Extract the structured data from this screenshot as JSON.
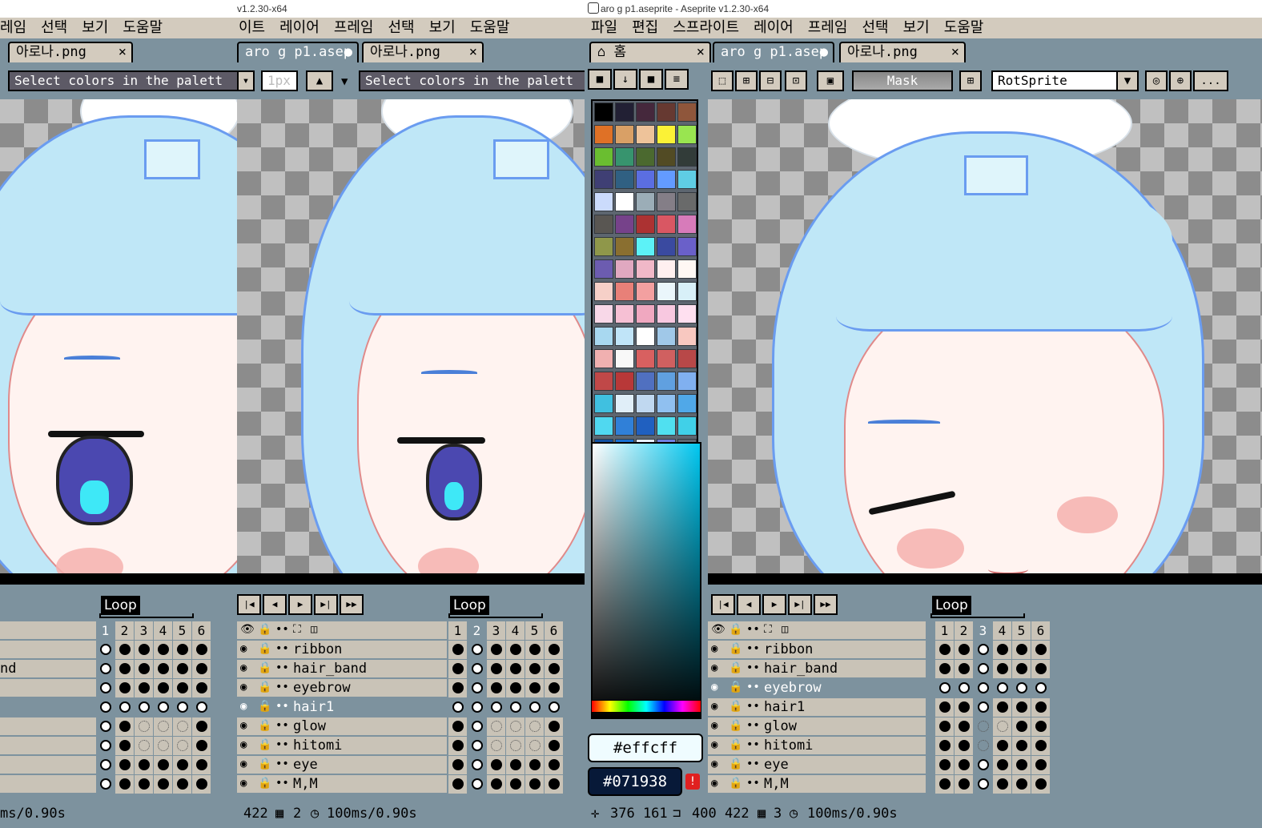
{
  "windows": {
    "left_title": "v1.2.30-x64",
    "right_title": "aro g p1.aseprite - Aseprite v1.2.30-x64"
  },
  "menus": {
    "partial_left": [
      "레임",
      "선택",
      "보기",
      "도움말"
    ],
    "middle": [
      "이트",
      "레이어",
      "프레임",
      "선택",
      "보기",
      "도움말"
    ],
    "right": [
      "파일",
      "편집",
      "스프라이트",
      "레이어",
      "프레임",
      "선택",
      "보기",
      "도움말"
    ]
  },
  "tabs": {
    "left": [
      {
        "label": "아로나.png",
        "close": "×"
      }
    ],
    "middle": [
      {
        "label": "aro g p1.asep",
        "modified": "●"
      },
      {
        "label": "아로나.png",
        "close": "×"
      }
    ],
    "right": [
      {
        "label": "홈",
        "close": "×",
        "icon": "home-icon"
      },
      {
        "label": "aro g p1.asep",
        "modified": "●"
      },
      {
        "label": "아로나.png",
        "close": "×"
      }
    ]
  },
  "toolbar": {
    "hint": "Select colors in the palett",
    "brush_size": "1px",
    "mask_label": "Mask",
    "rotation_algorithm": "RotSprite",
    "more_label": "..."
  },
  "timeline": {
    "loop_label": "Loop",
    "frame_numbers": [
      "1",
      "2",
      "3",
      "4",
      "5",
      "6"
    ],
    "layers": [
      "ribbon",
      "hair_band",
      "eyebrow",
      "hair1",
      "glow",
      "hitomi",
      "eye",
      "M,M"
    ],
    "left_partial_layer": "nd"
  },
  "palette": {
    "fg_hex": "#effcff",
    "bg_hex": "#071938",
    "colors": [
      "#000000",
      "#222034",
      "#45283c",
      "#663931",
      "#8f563b",
      "#df7126",
      "#d9a066",
      "#eec39a",
      "#fbf236",
      "#99e550",
      "#6abe30",
      "#37946e",
      "#4b692f",
      "#524b24",
      "#323c39",
      "#3f3f74",
      "#306082",
      "#5b6ee1",
      "#639bff",
      "#5fcde4",
      "#cbdbfc",
      "#ffffff",
      "#9badb7",
      "#847e87",
      "#696a6a",
      "#595652",
      "#76428a",
      "#ac3232",
      "#d95763",
      "#d77bba",
      "#8f974a",
      "#8a6f30",
      "#5cf2f7",
      "#3a4aa0",
      "#6a60c9",
      "#6c5cb0",
      "#e0a8c0",
      "#f0b8c8",
      "#fff0f0",
      "#fff8f4",
      "#f6d0c8",
      "#e88078",
      "#f3a0a0",
      "#eaf6fb",
      "#d8f0f8",
      "#f8d8e8",
      "#f6c0d4",
      "#f0a8c0",
      "#f8c8e0",
      "#ffe0f0",
      "#a8d8f0",
      "#c0e4f8",
      "#ffffff",
      "#a0c8e8",
      "#f8c8c0",
      "#f0b0b0",
      "#f8f8f8",
      "#d86060",
      "#d06060",
      "#b84848",
      "#c04848",
      "#b83838",
      "#5070c0",
      "#60a0e0",
      "#80b0f0",
      "#40c0e0",
      "#e0eef8",
      "#c0d8f0",
      "#90c0f0",
      "#50a8e8",
      "#50d8f0",
      "#3080d8",
      "#2060c0",
      "#50e0f0",
      "#40d0e8",
      "#1050a0",
      "#1870d0",
      "#e8f0ff",
      "#7080e0",
      "#5d6670"
    ]
  },
  "status": {
    "left": "ms/0.90s",
    "middle_size": "422",
    "middle_frame": "2",
    "middle_time": "100ms/0.90s",
    "right_cursor": "376 161",
    "right_size": "400 422",
    "right_frame": "3",
    "right_time": "100ms/0.90s"
  },
  "warning_glyph": "!"
}
